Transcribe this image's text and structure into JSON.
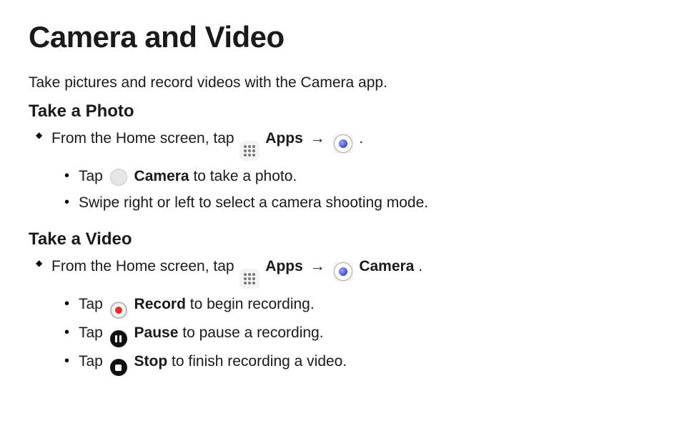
{
  "title": "Camera and Video",
  "intro": "Take pictures and record videos with the Camera app.",
  "photo": {
    "heading": "Take a Photo",
    "lead_before": "From the Home screen, tap ",
    "apps_label": "Apps",
    "arrow": "→",
    "lead_after": ".",
    "sub1_before": "Tap ",
    "sub1_bold": "Camera",
    "sub1_after": " to take a photo.",
    "sub2": "Swipe right or left to select a camera shooting mode."
  },
  "video": {
    "heading": "Take a Video",
    "lead_before": "From the Home screen, tap ",
    "apps_label": "Apps",
    "arrow": "→",
    "camera_label": "Camera",
    "lead_after": ".",
    "sub1_before": "Tap ",
    "sub1_bold": "Record",
    "sub1_after": " to begin recording.",
    "sub2_before": "Tap ",
    "sub2_bold": "Pause",
    "sub2_after": " to pause a recording.",
    "sub3_before": "Tap ",
    "sub3_bold": "Stop",
    "sub3_after": " to finish recording a video."
  }
}
